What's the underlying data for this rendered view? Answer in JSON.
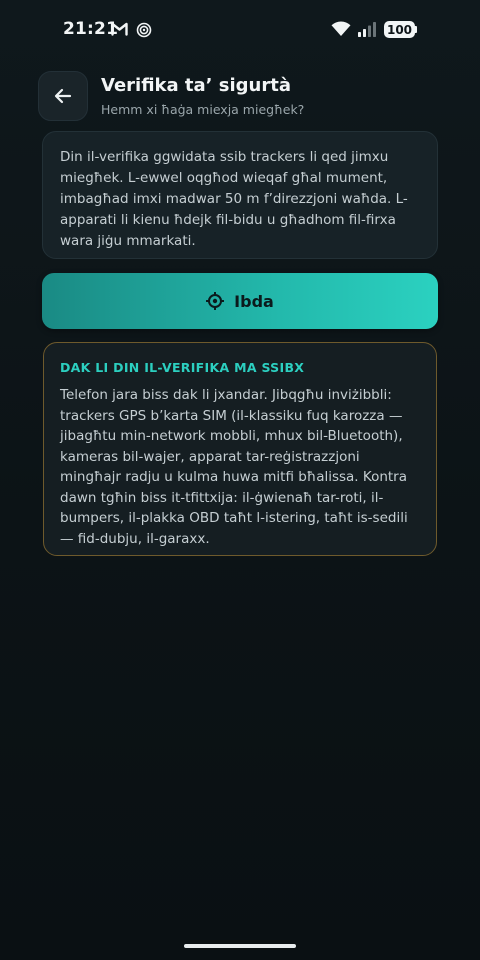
{
  "status_bar": {
    "time": "21:21",
    "icons": [
      "gmail-icon",
      "hotspot-icon",
      "wifi-icon",
      "signal-icon"
    ],
    "battery": "100"
  },
  "header": {
    "back_icon": "arrow-left-icon",
    "title": "Verifika ta’ sigurtà",
    "subtitle": "Hemm xi ħaġa miexja miegħek?"
  },
  "description": {
    "text": "Din il-verifika ggwidata ssib trackers li qed jimxu miegħek. L-ewwel oqgħod wieqaf għal mument, imbagħad imxi madwar 50 m f’direzzjoni waħda. L-apparati li kienu ħdejk fil-bidu u għadhom fil-firxa wara jiġu mmarkati."
  },
  "start_button": {
    "icon": "crosshair-icon",
    "label": "Ibda"
  },
  "info_card": {
    "title": "DAK LI DIN IL-VERIFIKA MA SSIBX",
    "text": "Telefon jara biss dak li jxandar. Jibqgħu inviżibbli: trackers GPS b’karta SIM (il-klassiku fuq karozza — jibagħtu min-network mobbli, mhux bil-Bluetooth), kameras bil-wajer, apparat tar-reġistrazzjoni mingħajr radju u kulma huwa mitfi bħalissa. Kontra dawn tgħin biss it-tfittxija: il-ġwienaħ tar-roti, il-bumpers, il-plakka OBD taħt l-istering, taħt is-sedili — fid-dubju, il-garaxx."
  },
  "colors": {
    "background": "#0d1418",
    "card": "#172227",
    "accent": "#2ccfc0",
    "warning_border": "#6e5a2c"
  }
}
